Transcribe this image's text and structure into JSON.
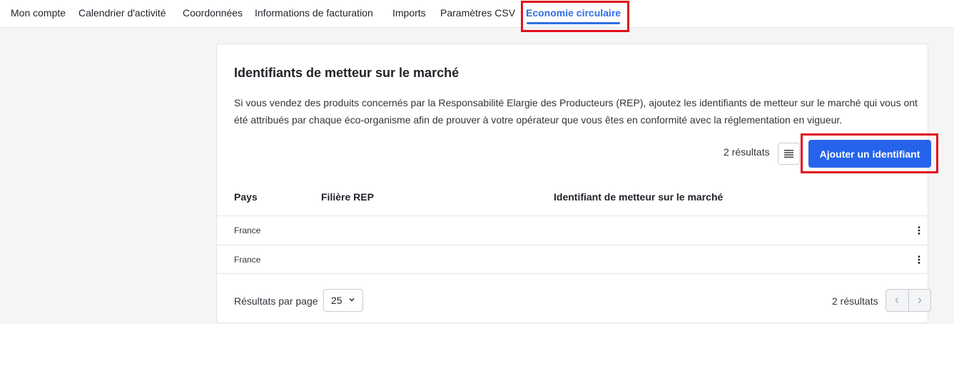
{
  "nav": {
    "tabs": [
      {
        "label": "Mon compte"
      },
      {
        "label": "Calendrier d'activité"
      },
      {
        "label": "Coordonnées"
      },
      {
        "label": "Informations de facturation"
      },
      {
        "label": "Imports"
      },
      {
        "label": "Paramètres CSV"
      },
      {
        "label": "Economie circulaire",
        "active": true
      }
    ]
  },
  "card": {
    "title": "Identifiants de metteur sur le marché",
    "description": "Si vous vendez des produits concernés par la Responsabilité Elargie des Producteurs (REP), ajoutez les identifiants de metteur sur le marché qui vous ont été attribués par chaque éco-organisme afin de prouver à votre opérateur que vous êtes en conformité avec la réglementation en vigueur.",
    "results_count": "2 résultats",
    "add_button": "Ajouter un identifiant",
    "density_icon": "list-density-icon"
  },
  "table": {
    "columns": [
      "Pays",
      "Filière REP",
      "Identifiant de metteur sur le marché"
    ],
    "rows": [
      {
        "pays": "France",
        "filiere": "",
        "identifiant": ""
      },
      {
        "pays": "France",
        "filiere": "",
        "identifiant": ""
      }
    ],
    "row_menu_icon": "kebab-menu-icon"
  },
  "footer": {
    "per_page_label": "Résultats par page",
    "per_page_value": "25",
    "results_count": "2 résultats",
    "prev_icon": "chevron-left-icon",
    "next_icon": "chevron-right-icon"
  },
  "colors": {
    "accent": "#2563eb",
    "active_tab": "#2f6fe4",
    "highlight": "#e0111d",
    "page_background": "#f5f5f5"
  }
}
